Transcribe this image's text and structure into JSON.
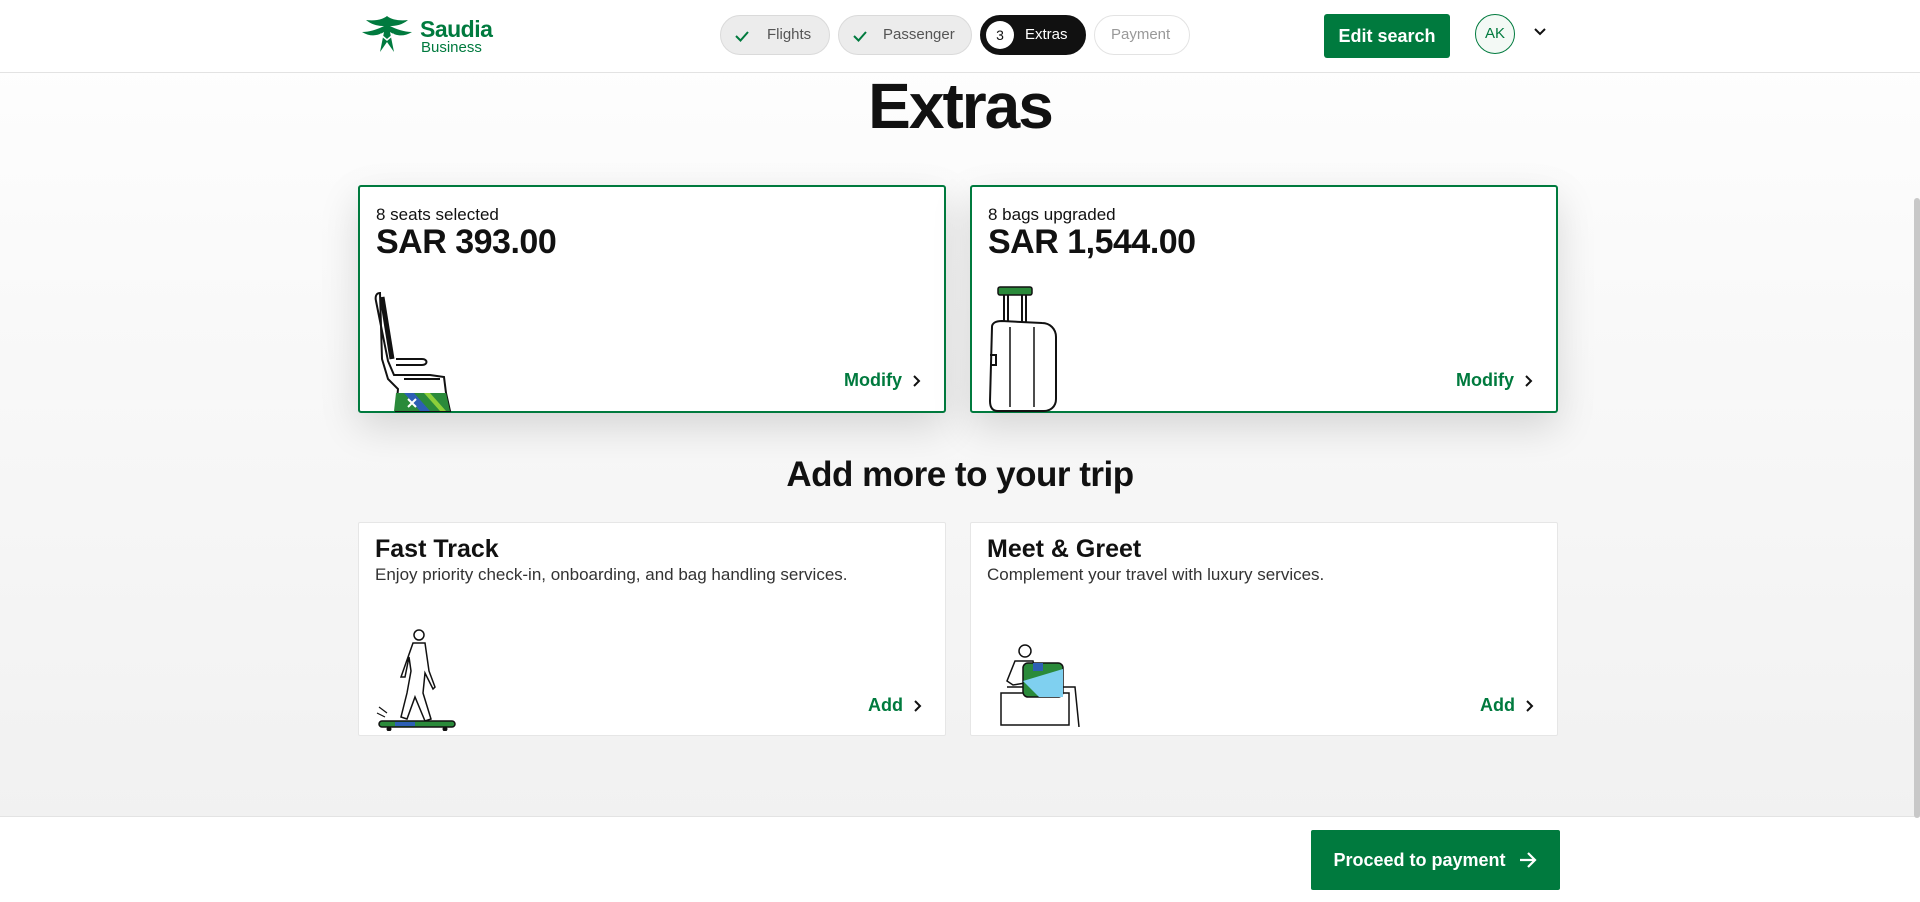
{
  "header": {
    "logo": {
      "line1": "Saudia",
      "line2": "Business"
    },
    "steps": [
      {
        "label": "Flights",
        "state": "done"
      },
      {
        "label": "Passenger",
        "state": "done"
      },
      {
        "number": "3",
        "label": "Extras",
        "state": "active"
      },
      {
        "label": "Payment",
        "state": "future"
      }
    ],
    "edit_search_label": "Edit search",
    "avatar_initials": "AK"
  },
  "main": {
    "title": "Extras",
    "selected_cards": [
      {
        "subtitle": "8 seats selected",
        "price": "SAR 393.00",
        "action": "Modify",
        "icon": "seat-icon"
      },
      {
        "subtitle": "8 bags upgraded",
        "price": "SAR 1,544.00",
        "action": "Modify",
        "icon": "luggage-icon"
      }
    ],
    "section_title": "Add more to your trip",
    "addon_cards": [
      {
        "title": "Fast Track",
        "description": "Enjoy priority check-in, onboarding, and bag handling services.",
        "action": "Add",
        "icon": "walking-person-icon"
      },
      {
        "title": "Meet & Greet",
        "description": "Complement your travel with luxury services.",
        "action": "Add",
        "icon": "person-with-bag-icon"
      }
    ]
  },
  "footer": {
    "proceed_label": "Proceed to payment"
  },
  "colors": {
    "brand_green": "#007a3e",
    "active_step": "#111111",
    "background": "#f2f2f2"
  }
}
